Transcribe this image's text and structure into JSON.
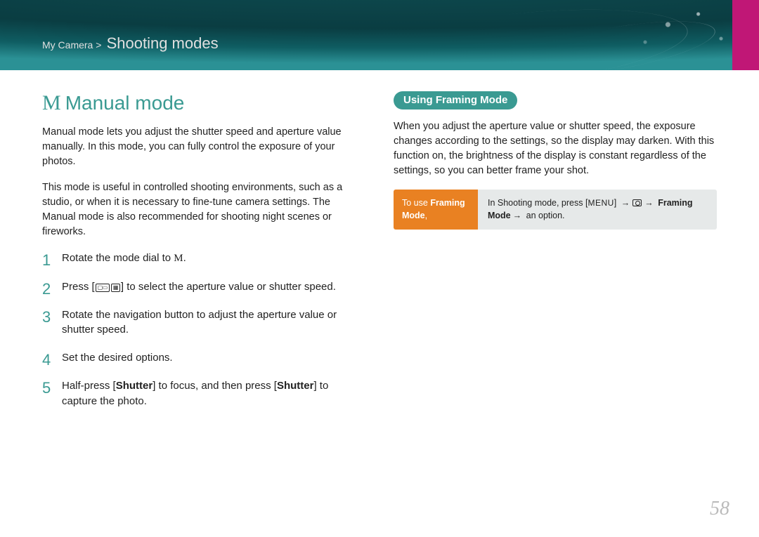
{
  "header": {
    "breadcrumb_parent": "My Camera >",
    "breadcrumb_title": "Shooting modes"
  },
  "left": {
    "title_letter": "M",
    "title_text": "Manual mode",
    "para1": "Manual mode lets you adjust the shutter speed and aperture value manually. In this mode, you can fully control the exposure of your photos.",
    "para2": "This mode is useful in controlled shooting environments, such as a studio, or when it is necessary to fine-tune camera settings. The Manual mode is also recommended for shooting night scenes or fireworks.",
    "steps": {
      "s1_pre": "Rotate the mode dial to ",
      "s1_mode": "M",
      "s1_post": ".",
      "s2_pre": "Press [",
      "s2_post": "] to select the aperture value or shutter speed.",
      "s3": "Rotate the navigation button to adjust the aperture value or shutter speed.",
      "s4": "Set the desired options.",
      "s5_a": "Half-press [",
      "s5_b": "Shutter",
      "s5_c": "] to focus, and then press [",
      "s5_d": "Shutter",
      "s5_e": "] to capture the photo."
    }
  },
  "right": {
    "pill": "Using Framing Mode",
    "para": "When you adjust the aperture value or shutter speed, the exposure changes according to the settings, so the display may darken. With this function on, the brightness of the display is constant regardless of the settings, so you can better frame your shot.",
    "tip_label_a": "To use ",
    "tip_label_b": "Framing Mode",
    "tip_label_c": ",",
    "tip_content_a": "In Shooting mode, press [",
    "tip_menu": "MENU",
    "tip_content_b": "] ",
    "tip_fm": "Framing Mode",
    "tip_content_c": " an option."
  },
  "page_number": "58"
}
